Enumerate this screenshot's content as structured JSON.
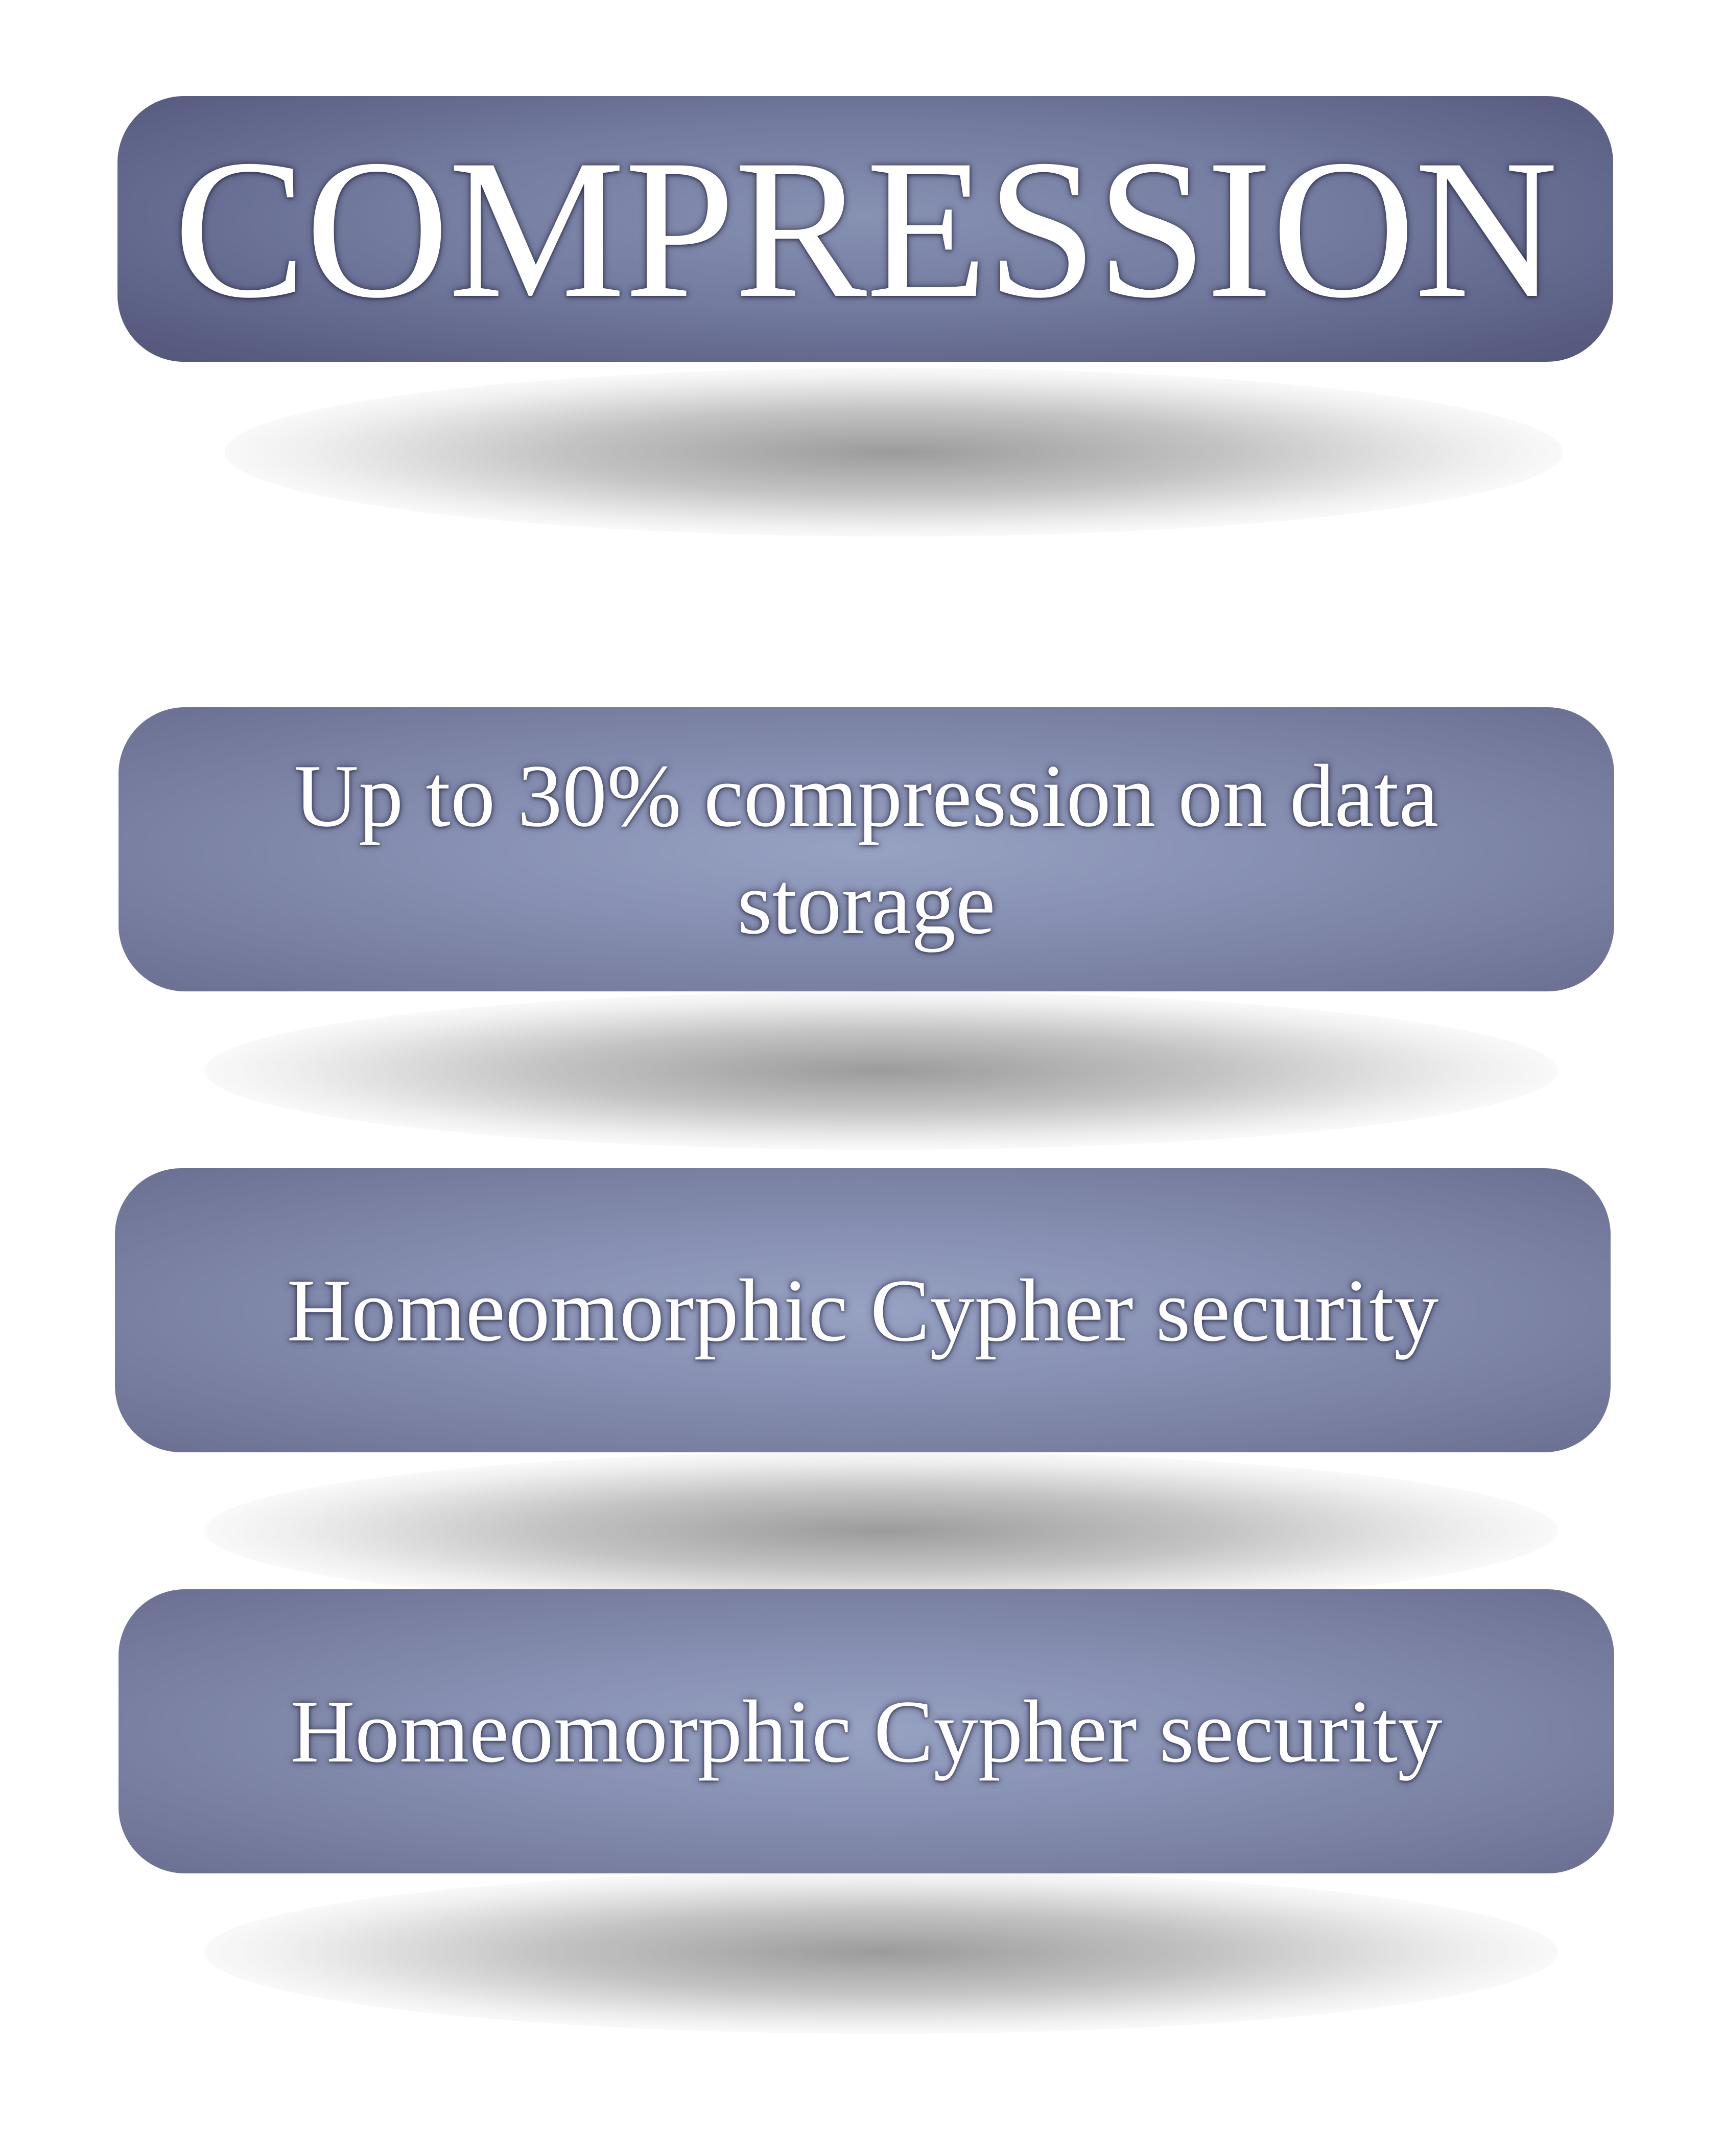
{
  "title": {
    "text": "COMPRESSION"
  },
  "features": [
    {
      "text": "Up to 30% compression on data storage"
    },
    {
      "text": "Homeomorphic Cypher security"
    },
    {
      "text": "Homeomorphic Cypher security"
    }
  ],
  "colors": {
    "panel_title_center": "#8791b2",
    "panel_title_edge": "#53567b",
    "panel_feature_center": "#97a1c2",
    "panel_feature_edge": "#6a6f91",
    "text": "#ffffff",
    "background": "#ffffff"
  }
}
